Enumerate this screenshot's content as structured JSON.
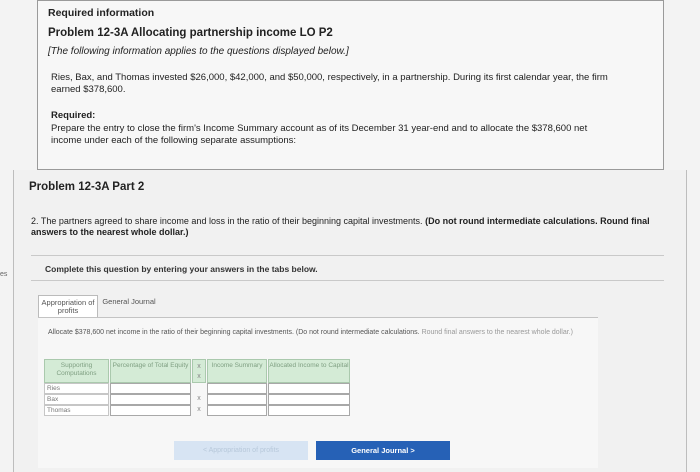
{
  "side_mark": "es",
  "info": {
    "required_title": "Required information",
    "problem_title": "Problem 12-3A Allocating partnership income LO P2",
    "note": "[The following information applies to the questions displayed below.]",
    "scenario_text": "Ries, Bax, and Thomas invested $26,000, $42,000, and $50,000, respectively, in a partnership. During its first calendar year, the firm earned $378,600.",
    "required_label": "Required:",
    "required_text": "Prepare the entry to close the firm's Income Summary account as of its December 31 year-end and to allocate the $378,600 net income under each of the following separate assumptions:"
  },
  "part": {
    "title": "Problem 12-3A Part 2",
    "question_text": "2. The partners agreed to share income and loss in the ratio of their beginning capital investments.",
    "question_bold": "(Do not round intermediate calculations. Round final answers to the nearest whole dollar.)",
    "complete_instruction": "Complete this question by entering your answers in the tabs below."
  },
  "tabs": [
    {
      "label": "Appropriation of profits"
    },
    {
      "label": "General Journal"
    }
  ],
  "instructions": {
    "text": "Allocate $378,600 net income in the ratio of their beginning capital investments. (Do not round intermediate calculations.",
    "faint": "Round final answers to the nearest whole dollar.)"
  },
  "table": {
    "headers": {
      "supporting": "Supporting Computations",
      "percentage": "Percentage of Total Equity",
      "op1": "x",
      "income": "Income Summary",
      "allocated": "Allocated Income to Capital"
    },
    "rows": [
      {
        "label": "Ries",
        "op": ""
      },
      {
        "label": "Bax",
        "op": "x"
      },
      {
        "label": "Thomas",
        "op": "x"
      }
    ],
    "row_ops_first": "x"
  },
  "nav": {
    "prev_label": "< Appropriation of profits",
    "next_label": "General Journal  >"
  },
  "colors": {
    "header_green": "#d4ebd6",
    "next_button": "#2661b6",
    "prev_button": "#d7e4f3"
  }
}
